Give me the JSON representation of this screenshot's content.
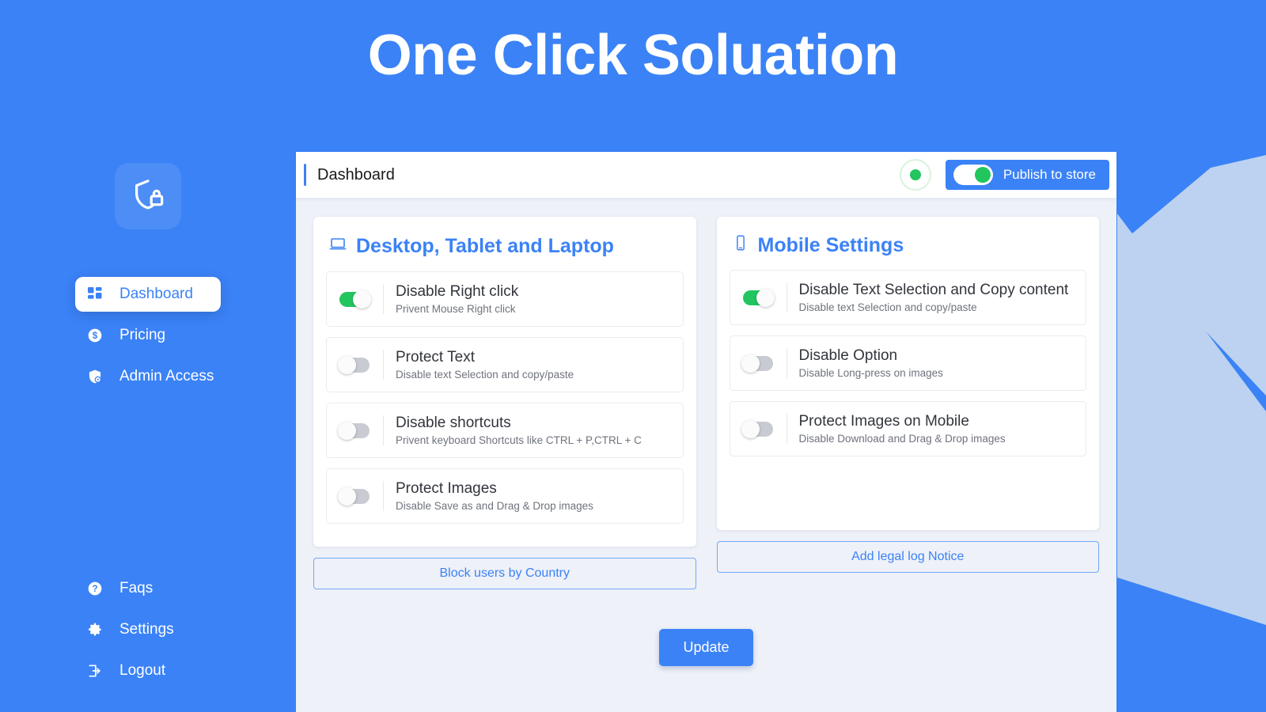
{
  "app": {
    "title": "One Click Soluation",
    "logo_icon": "shield-lock-icon",
    "background_color": "#3b82f6",
    "accent_color": "#3b82f6",
    "success_color": "#22c55e",
    "panel_background": "#eef1f8"
  },
  "sidebar": {
    "top_items": [
      {
        "label": "Dashboard",
        "icon": "grid-dashboard-icon",
        "active": true
      },
      {
        "label": "Pricing",
        "icon": "dollar-circle-icon",
        "active": false
      },
      {
        "label": "Admin Access",
        "icon": "shield-user-icon",
        "active": false
      }
    ],
    "bottom_items": [
      {
        "label": "Faqs",
        "icon": "question-circle-icon"
      },
      {
        "label": "Settings",
        "icon": "gear-icon"
      },
      {
        "label": "Logout",
        "icon": "logout-arrow-icon"
      }
    ]
  },
  "header": {
    "title": "Dashboard",
    "status_indicator": "online-green-dot",
    "publish": {
      "label": "Publish to store",
      "enabled": true
    }
  },
  "desktop_card": {
    "title": "Desktop, Tablet and Laptop",
    "icon": "laptop-icon",
    "settings": [
      {
        "title": "Disable Right click",
        "subtitle": "Privent Mouse Right click",
        "enabled": true
      },
      {
        "title": "Protect Text",
        "subtitle": "Disable text Selection and copy/paste",
        "enabled": false
      },
      {
        "title": "Disable shortcuts",
        "subtitle": "Privent keyboard Shortcuts like CTRL + P,CTRL + C",
        "enabled": false
      },
      {
        "title": "Protect Images",
        "subtitle": "Disable Save as and Drag & Drop images",
        "enabled": false
      }
    ],
    "action_label": "Block users by Country"
  },
  "mobile_card": {
    "title": "Mobile Settings",
    "icon": "mobile-phone-icon",
    "settings": [
      {
        "title": "Disable Text Selection and Copy content",
        "subtitle": "Disable text Selection and copy/paste",
        "enabled": true
      },
      {
        "title": "Disable Option",
        "subtitle": "Disable Long-press on images",
        "enabled": false
      },
      {
        "title": "Protect Images on Mobile",
        "subtitle": "Disable Download and Drag & Drop images",
        "enabled": false
      }
    ],
    "action_label": "Add legal log Notice"
  },
  "footer": {
    "update_label": "Update"
  }
}
